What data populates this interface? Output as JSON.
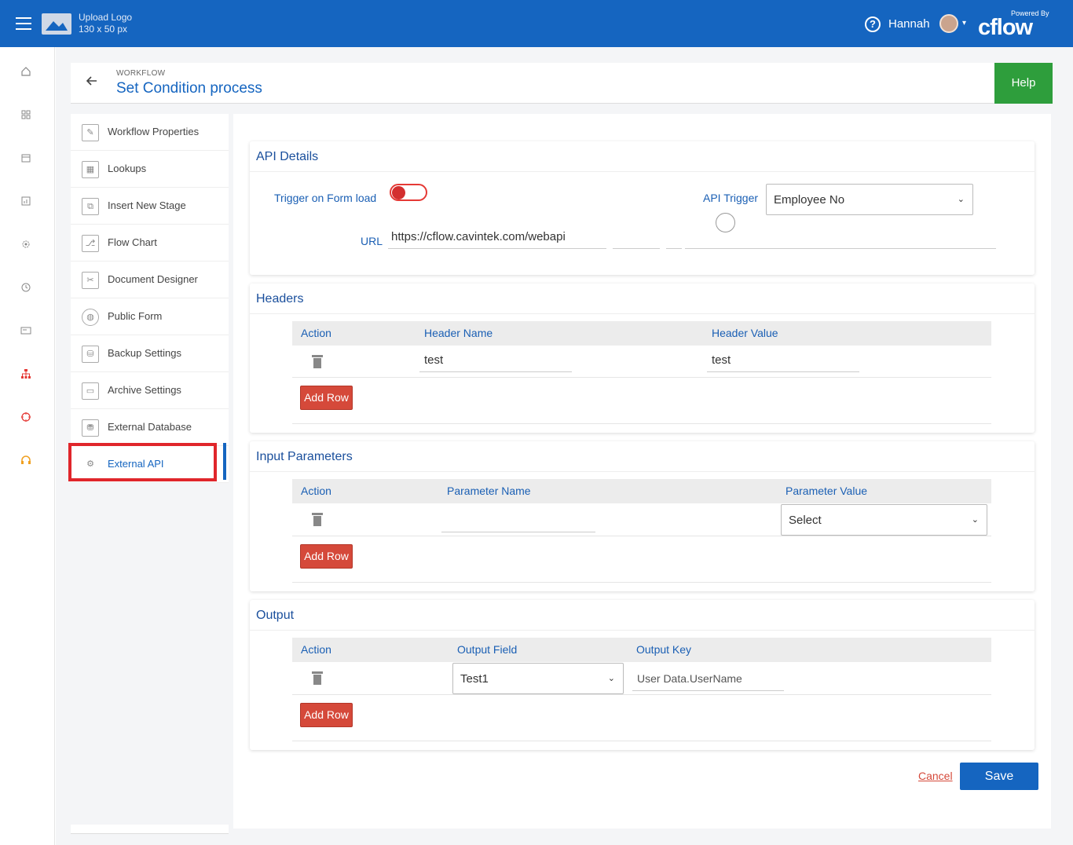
{
  "topbar": {
    "logo_line1": "Upload Logo",
    "logo_line2": "130 x 50 px",
    "username": "Hannah",
    "powered_by": "Powered By",
    "brand": "cflow",
    "help_glyph": "?",
    "bg_color": "#1565c0"
  },
  "rail": {
    "icons": [
      "home-icon",
      "apps-icon",
      "calendar-icon",
      "report-icon",
      "settings-icon",
      "history-icon",
      "board-icon",
      "org-icon",
      "target-icon",
      "support-icon"
    ]
  },
  "header": {
    "breadcrumb": "WORKFLOW",
    "title": "Set Condition process",
    "help_label": "Help"
  },
  "side_menu": {
    "items": [
      {
        "label": "Workflow Properties",
        "icon": "edit-icon"
      },
      {
        "label": "Lookups",
        "icon": "grid-icon"
      },
      {
        "label": "Insert New Stage",
        "icon": "stage-icon"
      },
      {
        "label": "Flow Chart",
        "icon": "flowchart-icon"
      },
      {
        "label": "Document Designer",
        "icon": "design-icon"
      },
      {
        "label": "Public Form",
        "icon": "globe-icon"
      },
      {
        "label": "Backup Settings",
        "icon": "backup-icon"
      },
      {
        "label": "Archive Settings",
        "icon": "archive-icon"
      },
      {
        "label": "External Database",
        "icon": "database-icon"
      },
      {
        "label": "External API",
        "icon": "api-gear-icon"
      }
    ]
  },
  "api_details": {
    "title": "API Details",
    "trigger_label": "Trigger on Form load",
    "api_trigger_label": "API Trigger",
    "api_trigger_value": "Employee No",
    "url_label": "URL",
    "url_value": "https://cflow.cavintek.com/webapi"
  },
  "headers": {
    "title": "Headers",
    "columns": [
      "Action",
      "Header Name",
      "Header Value"
    ],
    "rows": [
      {
        "name": "test",
        "value": "test"
      }
    ],
    "add_row": "Add Row"
  },
  "input_parameters": {
    "title": "Input Parameters",
    "columns": [
      "Action",
      "Parameter Name",
      "Parameter Value"
    ],
    "rows": [
      {
        "name": "",
        "value": "Select"
      }
    ],
    "add_row": "Add Row"
  },
  "output": {
    "title": "Output",
    "columns": [
      "Action",
      "Output Field",
      "Output Key"
    ],
    "rows": [
      {
        "field": "Test1",
        "key": "User Data.UserName"
      }
    ],
    "add_row": "Add Row"
  },
  "footer": {
    "cancel": "Cancel",
    "save": "Save"
  }
}
